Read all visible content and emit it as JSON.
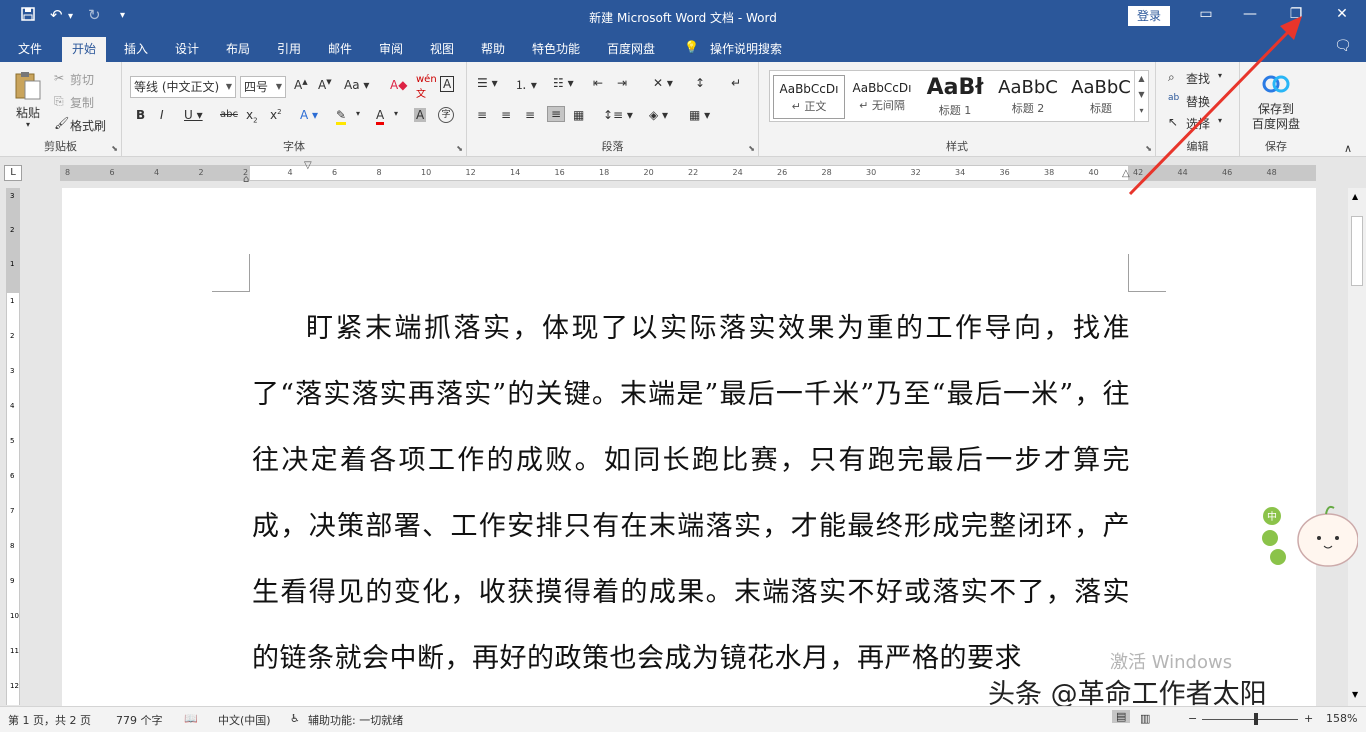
{
  "titlebar": {
    "title": "新建 Microsoft Word 文档 - Word",
    "login": "登录",
    "quick_access": [
      "save-icon",
      "undo-icon",
      "redo-icon",
      "customize-icon"
    ]
  },
  "menu": {
    "tabs": [
      "文件",
      "开始",
      "插入",
      "设计",
      "布局",
      "引用",
      "邮件",
      "审阅",
      "视图",
      "帮助",
      "特色功能",
      "百度网盘"
    ],
    "active": "开始",
    "search": "操作说明搜索"
  },
  "ribbon": {
    "clipboard": {
      "label": "剪贴板",
      "paste": "粘贴",
      "cut": "剪切",
      "copy": "复制",
      "format_painter": "格式刷"
    },
    "font": {
      "label": "字体",
      "font_name": "等线 (中文正文)",
      "font_size": "四号"
    },
    "paragraph": {
      "label": "段落"
    },
    "styles": {
      "label": "样式",
      "items": [
        {
          "sample": "AaBbCcDı",
          "name": "↵ 正文"
        },
        {
          "sample": "AaBbCcDı",
          "name": "↵ 无间隔"
        },
        {
          "sample": "AaBł",
          "name": "标题 1"
        },
        {
          "sample": "AaBbC",
          "name": "标题 2"
        },
        {
          "sample": "AaBbC",
          "name": "标题"
        }
      ]
    },
    "editing": {
      "label": "编辑",
      "find": "查找",
      "replace": "替换",
      "select": "选择"
    },
    "save": {
      "label": "保存",
      "button": "保存到\n百度网盘"
    }
  },
  "ruler": {
    "h_ticks": [
      "8",
      "6",
      "4",
      "2",
      "2",
      "4",
      "6",
      "8",
      "10",
      "12",
      "14",
      "16",
      "18",
      "20",
      "22",
      "24",
      "26",
      "28",
      "30",
      "32",
      "34",
      "36",
      "38",
      "40",
      "42",
      "44",
      "46",
      "48"
    ],
    "v_ticks": [
      "3",
      "2",
      "1",
      "1",
      "2",
      "3",
      "4",
      "5",
      "6",
      "7",
      "8",
      "9",
      "10",
      "11",
      "12"
    ]
  },
  "document": {
    "paragraph": "盯紧末端抓落实，体现了以实际落实效果为重的工作导向，找准了“落实落实再落实”的关键。末端是”最后一千米”乃至“最后一米”，往往决定着各项工作的成败。如同长跑比赛，只有跑完最后一步才算完成，决策部署、工作安排只有在末端落实，才能最终形成完整闭环，产生看得见的变化，收获摸得着的成果。末端落实不好或落实不了，落实的链条就会中断，再好的政策也会成为镜花水月，再严格的要求"
  },
  "statusbar": {
    "page": "第 1 页，共 2 页",
    "words": "779 个字",
    "language": "中文(中国)",
    "accessibility": "辅助功能: 一切就绪",
    "zoom": "158%"
  },
  "overlay": {
    "activate": "激活 Windows",
    "watermark": "头条 @革命工作者太阳"
  },
  "colors": {
    "title_bar": "#2b579a",
    "arrow": "#e8352b"
  }
}
